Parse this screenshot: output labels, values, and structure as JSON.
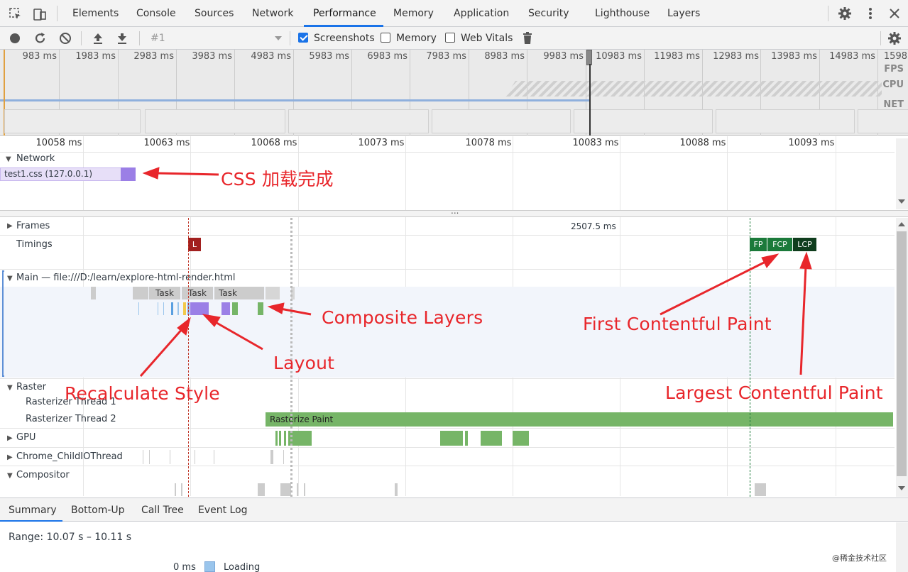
{
  "tabs": {
    "elements": "Elements",
    "console": "Console",
    "sources": "Sources",
    "network": "Network",
    "performance": "Performance",
    "memory": "Memory",
    "application": "Application",
    "security": "Security",
    "lighthouse": "Lighthouse",
    "layers": "Layers"
  },
  "toolbar": {
    "recording": "#1",
    "screenshots": "Screenshots",
    "memory": "Memory",
    "web_vitals": "Web Vitals"
  },
  "overview": {
    "ticks": [
      "983 ms",
      "1983 ms",
      "2983 ms",
      "3983 ms",
      "4983 ms",
      "5983 ms",
      "6983 ms",
      "7983 ms",
      "8983 ms",
      "9983 ms",
      "10983 ms",
      "11983 ms",
      "12983 ms",
      "13983 ms",
      "14983 ms",
      "1598"
    ],
    "fps": "FPS",
    "cpu": "CPU",
    "net": "NET"
  },
  "ruler": [
    "10058 ms",
    "10063 ms",
    "10068 ms",
    "10073 ms",
    "10078 ms",
    "10083 ms",
    "10088 ms",
    "10093 ms"
  ],
  "network": {
    "title": "Network",
    "request": "test1.css (127.0.0.1)"
  },
  "tracks": {
    "frames": "Frames",
    "frame_time": "2507.5 ms",
    "timings": "Timings",
    "marker_l": "L",
    "fp": "FP",
    "fcp": "FCP",
    "lcp": "LCP",
    "main": "Main — file:///D:/learn/explore-html-render.html",
    "task1": "Task",
    "task2": "Task",
    "task3": "Task",
    "raster": "Raster",
    "raster1": "Rasterizer Thread 1",
    "raster2": "Rasterizer Thread 2",
    "rasterize_paint": "Rasterize Paint",
    "gpu": "GPU",
    "childio": "Chrome_ChildIOThread",
    "compositor": "Compositor",
    "handle": "..."
  },
  "annotations": {
    "css": "CSS 加载完成",
    "composite": "Composite Layers",
    "layout": "Layout",
    "recalc": "Recalculate Style",
    "fcp": "First Contentful Paint",
    "lcp": "Largest Contentful Paint"
  },
  "bottom": {
    "summary": "Summary",
    "bottom_up": "Bottom-Up",
    "call_tree": "Call Tree",
    "event_log": "Event Log",
    "range": "Range: 10.07 s – 10.11 s",
    "loading_time": "0 ms",
    "loading": "Loading",
    "watermark": "@稀金技术社区"
  },
  "colors": {
    "accent": "#1a73e8",
    "loading": "#9ac5ec",
    "rendering": "#9b7fe6",
    "painting": "#76b567",
    "timing_l": "#a2201f",
    "timing_green": "#1b7a3a",
    "annotation": "#e8262b"
  }
}
